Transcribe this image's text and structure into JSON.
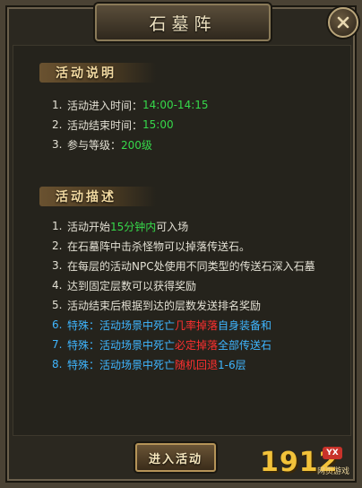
{
  "window": {
    "title": "石墓阵",
    "close_icon": "close-icon"
  },
  "sections": {
    "intro": {
      "header": "活动说明",
      "items": [
        {
          "num": "1.",
          "text": "活动进入时间：",
          "value": "14:00-14:15"
        },
        {
          "num": "2.",
          "text": "活动结束时间：",
          "value": "15:00"
        },
        {
          "num": "3.",
          "text": "参与等级：",
          "value": "200级"
        }
      ]
    },
    "desc": {
      "header": "活动描述",
      "items": [
        {
          "num": "1.",
          "a": "活动开始",
          "b": "15分钟内",
          "c": "可入场"
        },
        {
          "num": "2.",
          "a": "在石墓阵中击杀怪物可以掉落传送石。"
        },
        {
          "num": "3.",
          "a": "在每层的活动NPC处使用不同类型的传送石深入石墓"
        },
        {
          "num": "4.",
          "a": "达到固定层数可以获得奖励"
        },
        {
          "num": "5.",
          "a": "活动结束后根据到达的层数发送排名奖励"
        },
        {
          "num": "6.",
          "a": "特殊：活动场景中死亡",
          "b": "几率掉落",
          "c": "自身装备和"
        },
        {
          "num": "7.",
          "a": "特殊：活动场景中死亡",
          "b": "必定掉落",
          "c": "全部传送石"
        },
        {
          "num": "8.",
          "a": "特殊：活动场景中死亡",
          "b": "随机回退",
          "c": "1-6层"
        }
      ]
    }
  },
  "footer": {
    "enter_button": "进入活动",
    "logo_text": "1912",
    "logo_badge": "YX",
    "logo_sub": "网页游戏"
  },
  "colors": {
    "highlight_green": "#36d84a",
    "special_blue": "#3fb6ff",
    "warning_red": "#ff3030"
  }
}
